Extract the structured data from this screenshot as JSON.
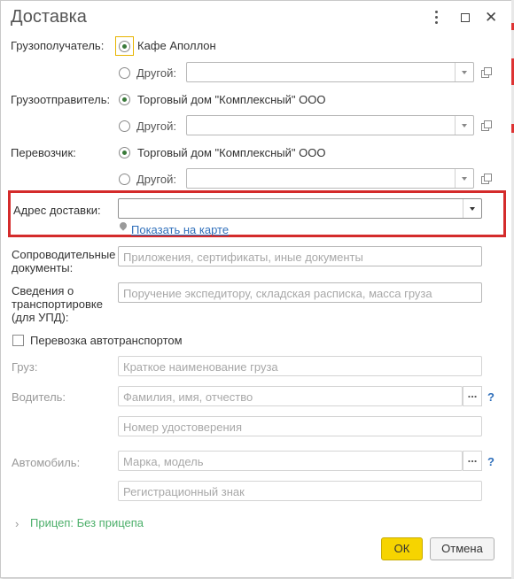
{
  "window": {
    "title": "Доставка",
    "controls": [
      "more-icon",
      "maximize-icon",
      "close-icon"
    ]
  },
  "consignee": {
    "label": "Грузополучатель:",
    "option_selected": "Кафе Аполлон",
    "option_other": "Другой:"
  },
  "shipper": {
    "label": "Грузоотправитель:",
    "option_selected": "Торговый дом \"Комплексный\" ООО",
    "option_other": "Другой:"
  },
  "carrier": {
    "label": "Перевозчик:",
    "option_selected": "Торговый дом \"Комплексный\" ООО",
    "option_other": "Другой:"
  },
  "delivery_address": {
    "label": "Адрес доставки:",
    "value": "",
    "map_link": "Показать на карте"
  },
  "documents": {
    "label": "Сопроводительные документы:",
    "placeholder": "Приложения, сертификаты, иные документы"
  },
  "transport_info": {
    "label": "Сведения о транспортировке (для УПД):",
    "placeholder": "Поручение экспедитору, складская расписка, масса груза"
  },
  "auto_transport": {
    "label": "Перевозка автотранспортом",
    "checked": false
  },
  "cargo": {
    "label": "Груз:",
    "placeholder": "Краткое наименование груза"
  },
  "driver": {
    "label": "Водитель:",
    "name_placeholder": "Фамилия, имя, отчество",
    "license_placeholder": "Номер удостоверения",
    "help": "?"
  },
  "vehicle": {
    "label": "Автомобиль:",
    "model_placeholder": "Марка, модель",
    "plate_placeholder": "Регистрационный знак",
    "help": "?"
  },
  "trailer": {
    "label": "Прицеп: Без прицепа"
  },
  "buttons": {
    "ok": "ОК",
    "cancel": "Отмена"
  },
  "colors": {
    "highlight": "#d42b2b",
    "link": "#2f6fbb",
    "ok_button": "#f6d400",
    "trailer_link": "#4caf6a"
  }
}
